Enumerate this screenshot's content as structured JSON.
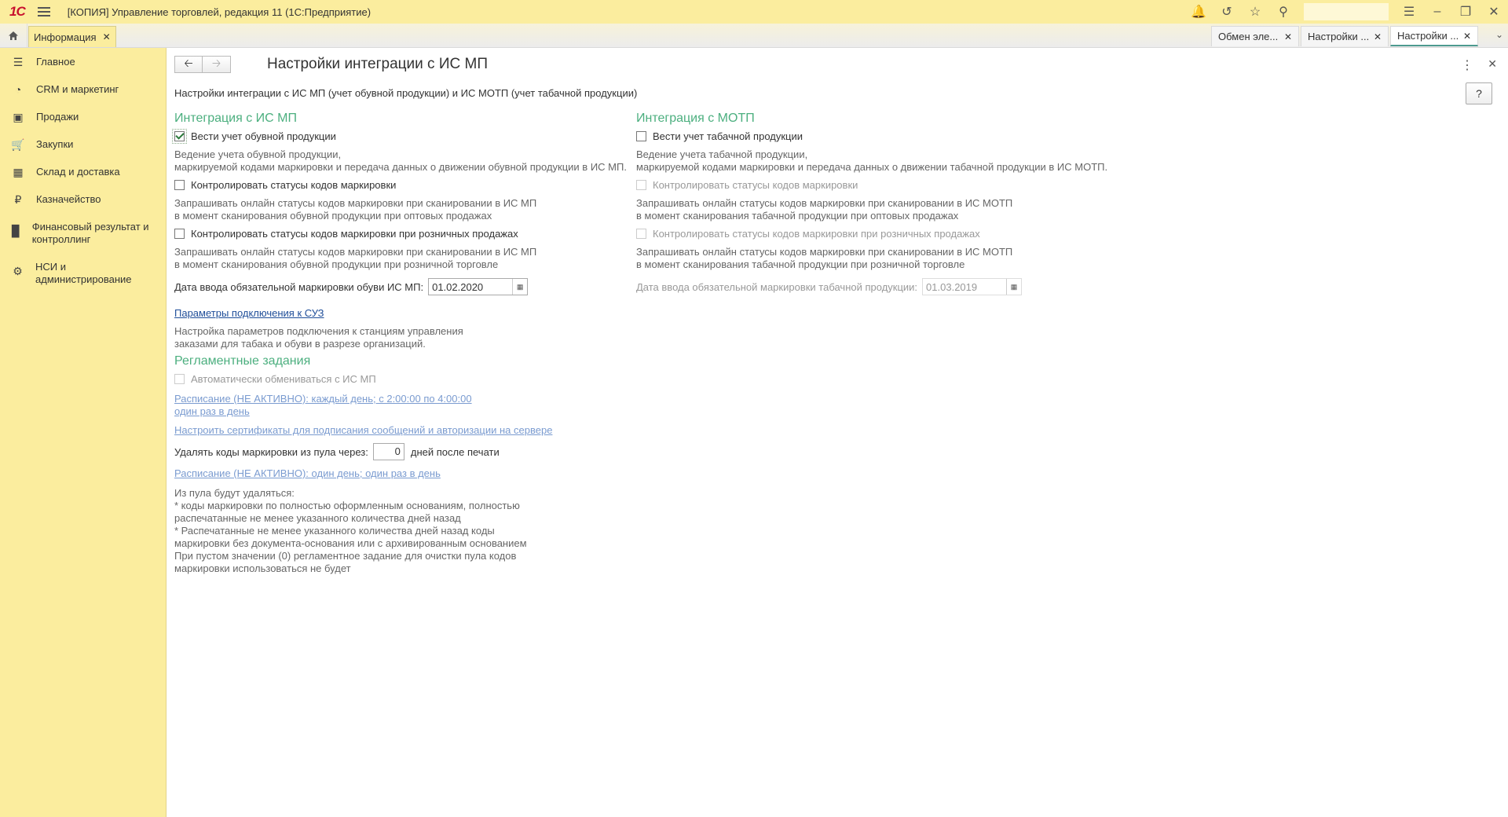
{
  "titlebar": {
    "logo": "1С",
    "title": "[КОПИЯ] Управление торговлей, редакция 11  (1С:Предприятие)"
  },
  "tabs": {
    "home_icon": "home-icon",
    "info": "Информация",
    "open": [
      {
        "label": "Обмен эле..."
      },
      {
        "label": "Настройки ..."
      },
      {
        "label": "Настройки ..."
      }
    ]
  },
  "sidebar": {
    "items": [
      {
        "label": "Главное",
        "icon": "menu-icon"
      },
      {
        "label": "CRM и маркетинг",
        "icon": "pie-chart-icon"
      },
      {
        "label": "Продажи",
        "icon": "bag-icon"
      },
      {
        "label": "Закупки",
        "icon": "cart-icon"
      },
      {
        "label": "Склад и доставка",
        "icon": "warehouse-icon"
      },
      {
        "label": "Казначейство",
        "icon": "ruble-icon"
      },
      {
        "label": "Финансовый результат и контроллинг",
        "icon": "bar-chart-icon"
      },
      {
        "label": "НСИ и администрирование",
        "icon": "gear-icon"
      }
    ]
  },
  "form": {
    "title": "Настройки интеграции с ИС МП",
    "subtitle": "Настройки интеграции с ИС МП (учет обувной продукции) и ИС МОТП (учет табачной продукции)",
    "help": "?",
    "left": {
      "section": "Интеграция с ИС МП",
      "chk1": "Вести учет обувной продукции",
      "desc1a": "Ведение учета обувной продукции,",
      "desc1b": "маркируемой кодами маркировки и передача данных о движении обувной продукции в ИС МП.",
      "chk2": "Контролировать статусы кодов маркировки",
      "desc2a": "Запрашивать онлайн статусы кодов маркировки при сканировании в ИС МП",
      "desc2b": "в момент сканирования обувной продукции при оптовых продажах",
      "chk3": "Контролировать статусы кодов маркировки при розничных продажах",
      "desc3a": "Запрашивать онлайн статусы кодов маркировки при сканировании в ИС МП",
      "desc3b": "в момент сканирования обувной продукции при розничной торговле",
      "date_label": "Дата ввода обязательной маркировки обуви ИС МП:",
      "date_value": "01.02.2020",
      "suz_link": "Параметры подключения к СУЗ",
      "suz_desc_a": "Настройка параметров подключения к станциям управления",
      "suz_desc_b": "заказами для табака и обуви в разрезе организаций.",
      "section2": "Регламентные задания",
      "auto_exchange": "Автоматически обмениваться с ИС МП",
      "schedule1_a": "Расписание (НЕ АКТИВНО): каждый день; с 2:00:00 по 4:00:00",
      "schedule1_b": "один раз в день",
      "cert_link": "Настроить сертификаты для подписания сообщений и авторизации на сервере",
      "delete_label": "Удалять коды маркировки из пула через:",
      "delete_value": "0",
      "delete_suffix": "дней после печати",
      "schedule2": "Расписание (НЕ АКТИВНО): один день; один раз в день",
      "note": [
        "Из пула будут удаляться:",
        " * коды маркировки по полностью оформленным основаниям, полностью",
        "распечатанные не менее указанного количества дней назад",
        " * Распечатанные не менее указанного количества дней назад коды",
        "маркировки без документа-основания или с архивированным основанием",
        "При пустом значении (0) регламентное задание для очистки пула кодов",
        "маркировки использоваться не будет"
      ]
    },
    "right": {
      "section": "Интеграция с МОТП",
      "chk1": "Вести учет табачной продукции",
      "desc1a": "Ведение учета табачной продукции,",
      "desc1b": "маркируемой кодами маркировки и передача данных о движении табачной продукции в ИС МОТП.",
      "chk2": "Контролировать статусы кодов маркировки",
      "desc2a": "Запрашивать онлайн статусы кодов маркировки при сканировании в ИС МОТП",
      "desc2b": "в момент сканирования табачной продукции при оптовых продажах",
      "chk3": "Контролировать статусы кодов маркировки при розничных продажах",
      "desc3a": "Запрашивать онлайн статусы кодов маркировки при сканировании в ИС МОТП",
      "desc3b": "в момент сканирования табачной продукции при розничной торговле",
      "date_label": "Дата ввода обязательной маркировки табачной продукции:",
      "date_value": "01.03.2019"
    }
  },
  "colors": {
    "titlebar": "#fbed9e",
    "section": "#4caf7f",
    "link": "#1f4e99"
  }
}
